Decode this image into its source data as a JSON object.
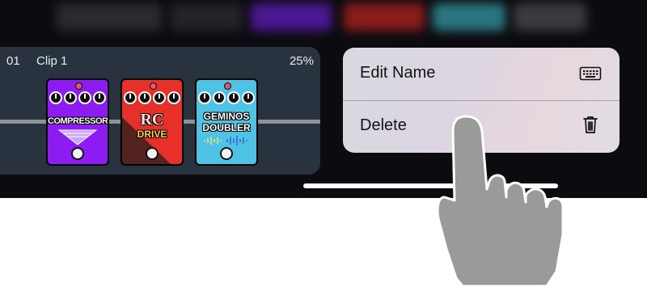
{
  "colors": {
    "clip_bg": "#28333f",
    "menu_bg": "#dcd8e0",
    "compressor": "#8d1cf2",
    "rc_drive": "#e8302a",
    "geminos_doubler": "#4fc3e6"
  },
  "clip": {
    "number": "01",
    "name": "Clip 1",
    "percent": "25%",
    "pedals": [
      {
        "title": "COMPRESSOR",
        "color": "#8d1cf2"
      },
      {
        "title_line1": "RC",
        "title_line2": "DRIVE",
        "color": "#e8302a"
      },
      {
        "title_line1": "GEMINOS",
        "title_line2": "DOUBLER",
        "color": "#4fc3e6"
      }
    ]
  },
  "context_menu": {
    "items": [
      {
        "label": "Edit Name",
        "icon": "keyboard-icon"
      },
      {
        "label": "Delete",
        "icon": "trash-icon"
      }
    ]
  },
  "gesture": {
    "icon": "pointing-hand-icon"
  }
}
